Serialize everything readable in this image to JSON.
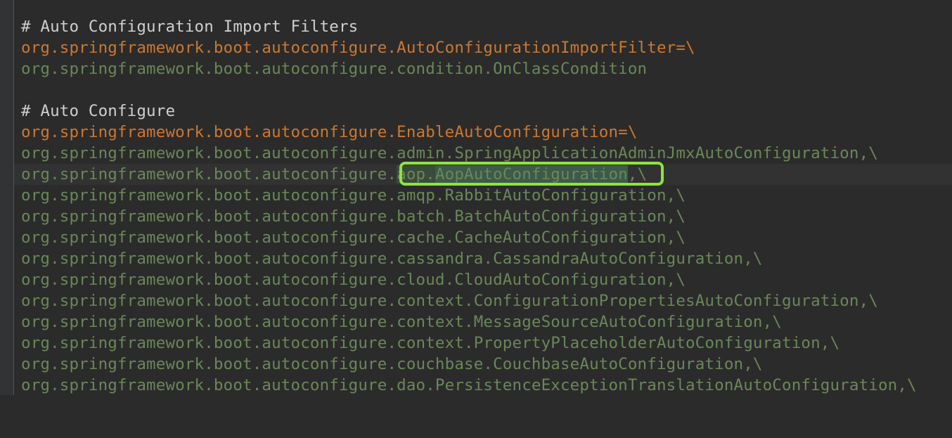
{
  "editor": {
    "lines": [
      {
        "type": "comment",
        "text": "# Auto Configuration Import Filters"
      },
      {
        "type": "key",
        "text": "org.springframework.boot.autoconfigure.AutoConfigurationImportFilter=\\"
      },
      {
        "type": "val",
        "text": "org.springframework.boot.autoconfigure.condition.OnClassCondition"
      },
      {
        "type": "blank",
        "text": ""
      },
      {
        "type": "comment",
        "text": "# Auto Configure"
      },
      {
        "type": "key",
        "text": "org.springframework.boot.autoconfigure.EnableAutoConfiguration=\\"
      },
      {
        "type": "val",
        "text": "org.springframework.boot.autoconfigure.admin.SpringApplicationAdminJmxAutoConfiguration,\\"
      },
      {
        "type": "val-highlight",
        "prefix": "org.springframework.boot.autoconfigure.",
        "pkg": "aop.",
        "cls": "AopAutoConfiguration",
        "suffix": ",\\"
      },
      {
        "type": "val",
        "text": "org.springframework.boot.autoconfigure.amqp.RabbitAutoConfiguration,\\"
      },
      {
        "type": "val",
        "text": "org.springframework.boot.autoconfigure.batch.BatchAutoConfiguration,\\"
      },
      {
        "type": "val",
        "text": "org.springframework.boot.autoconfigure.cache.CacheAutoConfiguration,\\"
      },
      {
        "type": "val",
        "text": "org.springframework.boot.autoconfigure.cassandra.CassandraAutoConfiguration,\\"
      },
      {
        "type": "val",
        "text": "org.springframework.boot.autoconfigure.cloud.CloudAutoConfiguration,\\"
      },
      {
        "type": "val",
        "text": "org.springframework.boot.autoconfigure.context.ConfigurationPropertiesAutoConfiguration,\\"
      },
      {
        "type": "val",
        "text": "org.springframework.boot.autoconfigure.context.MessageSourceAutoConfiguration,\\"
      },
      {
        "type": "val",
        "text": "org.springframework.boot.autoconfigure.context.PropertyPlaceholderAutoConfiguration,\\"
      },
      {
        "type": "val",
        "text": "org.springframework.boot.autoconfigure.couchbase.CouchbaseAutoConfiguration,\\"
      },
      {
        "type": "val",
        "text": "org.springframework.boot.autoconfigure.dao.PersistenceExceptionTranslationAutoConfiguration,\\"
      }
    ]
  },
  "colors": {
    "background": "#2b2b2b",
    "comment": "#cfcfcf",
    "key": "#cc7832",
    "value": "#6a8759",
    "callout": "#8fe33f"
  }
}
